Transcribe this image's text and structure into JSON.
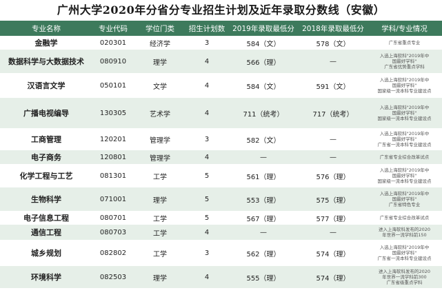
{
  "title": "广州大学2020年分省分专业招生计划及近年录取分数线（安徽）",
  "headers": [
    "专业名称",
    "专业代码",
    "学位门类",
    "招生计划数",
    "2019年录取最低分",
    "2018年录取最低分",
    "学科/专业情况"
  ],
  "rows": [
    {
      "name": "金融学",
      "code": "020301",
      "degree": "经济学",
      "plan": "3",
      "s2019": "584（文）",
      "s2018": "578（文）",
      "notes": [
        "广东省重点专业"
      ]
    },
    {
      "name": "数据科学与大数据技术",
      "code": "080910",
      "degree": "理学",
      "plan": "4",
      "s2019": "566（理）",
      "s2018": "—",
      "notes": [
        "入选上海软科\"2019年中",
        "国最好学科\"",
        "广东省优势重点学科"
      ]
    },
    {
      "name": "汉语言文学",
      "code": "050101",
      "degree": "文学",
      "plan": "4",
      "s2019": "584（文）",
      "s2018": "591（文）",
      "notes": [
        "入选上海软科\"2019年中",
        "国最好学科\"",
        "国家级一流本科专业建设点"
      ]
    },
    {
      "name": "广播电视编导",
      "code": "130305",
      "degree": "艺术学",
      "plan": "4",
      "s2019": "711（统考）",
      "s2018": "717（统考）",
      "notes": [
        "入选上海软科\"2019年中",
        "国最好学科\"",
        "国家级一流本科专业建设点"
      ]
    },
    {
      "name": "工商管理",
      "code": "120201",
      "degree": "管理学",
      "plan": "3",
      "s2019": "582（文）",
      "s2018": "—",
      "notes": [
        "入选上海软科\"2019年中",
        "国最好学科\"",
        "广东省一流本科专业建设点"
      ]
    },
    {
      "name": "电子商务",
      "code": "120801",
      "degree": "管理学",
      "plan": "4",
      "s2019": "—",
      "s2018": "—",
      "notes": [
        "广东省专业综合改革试点"
      ]
    },
    {
      "name": "化学工程与工艺",
      "code": "081301",
      "degree": "工学",
      "plan": "5",
      "s2019": "561（理）",
      "s2018": "576（理）",
      "notes": [
        "入选上海软科\"2019年中",
        "国最好学科\"",
        "国家级一流本科专业建设点"
      ]
    },
    {
      "name": "生物科学",
      "code": "071001",
      "degree": "理学",
      "plan": "5",
      "s2019": "553（理）",
      "s2018": "575（理）",
      "notes": [
        "入选上海软科\"2019年中",
        "国最好学科\"",
        "广东省特色专业"
      ]
    },
    {
      "name": "电子信息工程",
      "code": "080701",
      "degree": "工学",
      "plan": "5",
      "s2019": "567（理）",
      "s2018": "577（理）",
      "notes": [
        "广东省专业综合改革试点"
      ]
    },
    {
      "name": "通信工程",
      "code": "080703",
      "degree": "工学",
      "plan": "4",
      "s2019": "—",
      "s2018": "—",
      "notes": [
        "进入上海软科发布的2020",
        "年世界一流学科前150"
      ]
    },
    {
      "name": "城乡规划",
      "code": "082802",
      "degree": "工学",
      "plan": "3",
      "s2019": "562（理）",
      "s2018": "574（理）",
      "notes": [
        "入选上海软科\"2019年中",
        "国最好学科\"",
        "广东省一流本科专业建设点"
      ]
    },
    {
      "name": "环境科学",
      "code": "082503",
      "degree": "理学",
      "plan": "4",
      "s2019": "555（理）",
      "s2018": "574（理）",
      "notes": [
        "进入上海软科发布的2020",
        "年世界一流学科前300",
        "广东省级重点学科"
      ]
    }
  ]
}
